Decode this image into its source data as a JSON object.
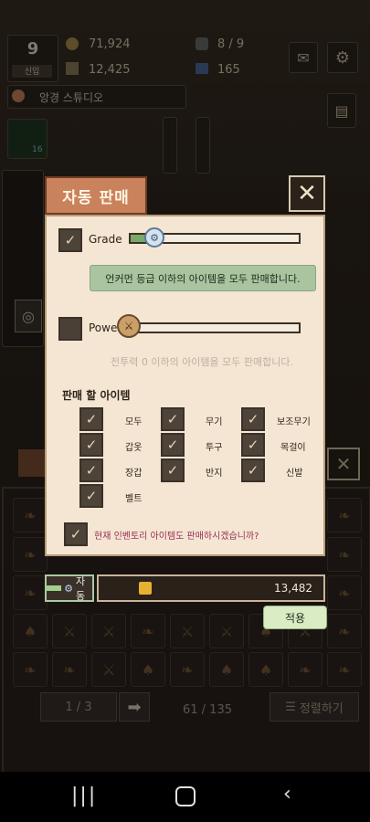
{
  "hud": {
    "level": "9",
    "level_caption": "신입",
    "coins": "71,924",
    "coins2": "12,425",
    "stamina": "8 / 9",
    "gems": "165",
    "studio_name": "앙경 스튜디오",
    "slot_badge": "16"
  },
  "dialog": {
    "title": "자동 판매",
    "grade_label": "Grade",
    "grade_value": 0.15,
    "grade_info": "언커먼 등급 이하의 아이템을 모두 판매합니다.",
    "power_label": "Power",
    "power_value": 0.0,
    "power_info": "전투력 0 이하의 아이템을 모두 판매합니다.",
    "items_title": "판매 할 아이템",
    "items": [
      {
        "label": "모두",
        "checked": true
      },
      {
        "label": "무기",
        "checked": true
      },
      {
        "label": "보조무기",
        "checked": true
      },
      {
        "label": "갑옷",
        "checked": true
      },
      {
        "label": "투구",
        "checked": true
      },
      {
        "label": "목걸이",
        "checked": true
      },
      {
        "label": "장갑",
        "checked": true
      },
      {
        "label": "반지",
        "checked": true
      },
      {
        "label": "신발",
        "checked": true
      },
      {
        "label": "벨트",
        "checked": true
      }
    ],
    "inventory_confirm": "현재 인벤토리 아이템도 판매하시겠습니까?"
  },
  "bottom": {
    "auto_label": "자동",
    "gold_amount": "13,482",
    "apply_label": "적용",
    "page": "1 / 3",
    "count": "61 / 135",
    "sort_label": "정렬하기"
  },
  "colors": {
    "tab": "#c9825b",
    "panel": "#f4e6d2",
    "info_green": "#a9c49f",
    "apply": "#d9ecc4"
  }
}
